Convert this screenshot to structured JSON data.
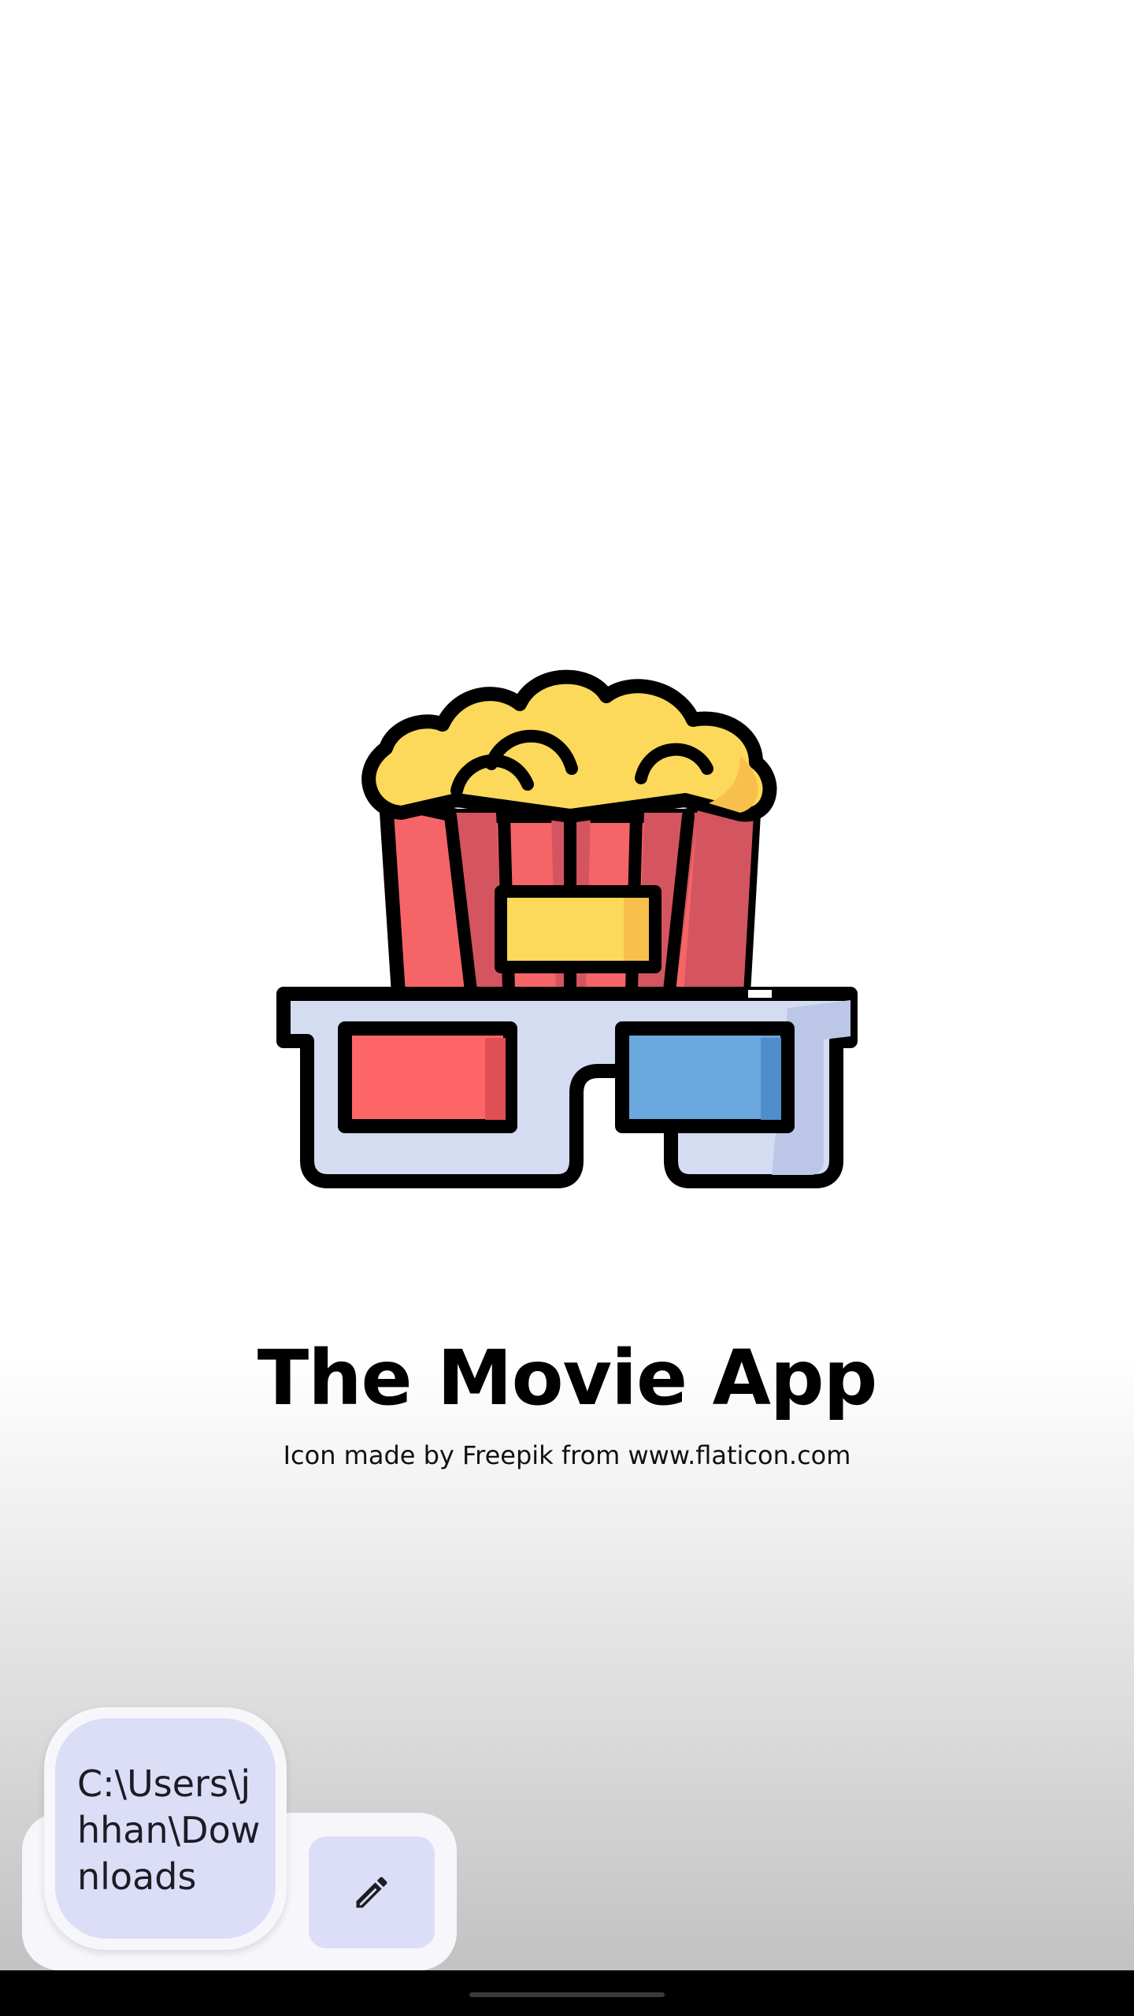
{
  "app": {
    "title": "The Movie App",
    "credit": "Icon made by Freepik from www.flaticon.com"
  },
  "file_path_chip": {
    "text": "C:\\Users\\jhhan\\Downloads"
  },
  "toolbar": {
    "edit_icon": "pencil-icon"
  },
  "colors": {
    "popcorn": "#FCD95A",
    "stripe_red": "#F56567",
    "stripe_dark": "#D45560",
    "glasses_frame": "#D4DCF2",
    "lens_red": "#FE6667",
    "lens_blue": "#6AA8DE",
    "chip_bg": "#DCDEF8"
  }
}
